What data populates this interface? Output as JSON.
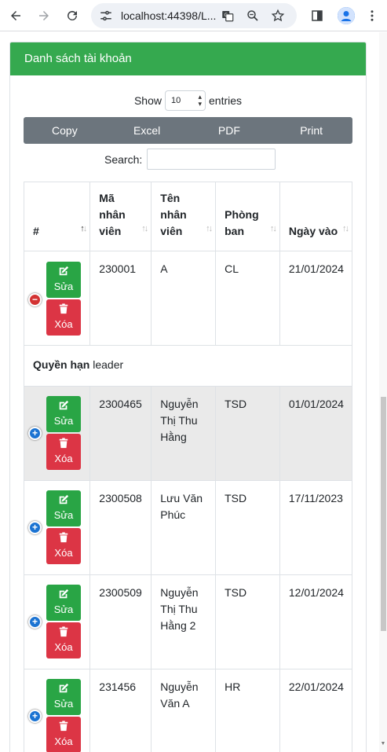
{
  "browser": {
    "url": "localhost:44398/L..."
  },
  "card": {
    "title": "Danh sách tài khoản"
  },
  "length": {
    "show": "Show",
    "value": "10",
    "entries": "entries"
  },
  "buttons": [
    "Copy",
    "Excel",
    "PDF",
    "Print"
  ],
  "search": {
    "label": "Search:"
  },
  "table": {
    "headers": [
      {
        "label": "#"
      },
      {
        "label": "Mã nhân viên"
      },
      {
        "label": "Tên nhân viên"
      },
      {
        "label": "Phòng ban"
      },
      {
        "label": "Ngày vào"
      }
    ],
    "edit_label": "Sửa",
    "delete_label": "Xóa",
    "rows": [
      {
        "ma": "230001",
        "ten": "A",
        "phong": "CL",
        "ngay": "21/01/2024",
        "expanded": true
      },
      {
        "ma": "2300465",
        "ten": "Nguyễn Thị Thu Hằng",
        "phong": "TSD",
        "ngay": "01/01/2024",
        "expanded": false
      },
      {
        "ma": "2300508",
        "ten": "Lưu Văn Phúc",
        "phong": "TSD",
        "ngay": "17/11/2023",
        "expanded": false
      },
      {
        "ma": "2300509",
        "ten": "Nguyễn Thị Thu Hằng 2",
        "phong": "TSD",
        "ngay": "12/01/2024",
        "expanded": false
      },
      {
        "ma": "231456",
        "ten": "Nguyễn Văn A",
        "phong": "HR",
        "ngay": "22/01/2024",
        "expanded": false
      }
    ],
    "child": {
      "label": "Quyền hạn",
      "value": "leader"
    }
  }
}
